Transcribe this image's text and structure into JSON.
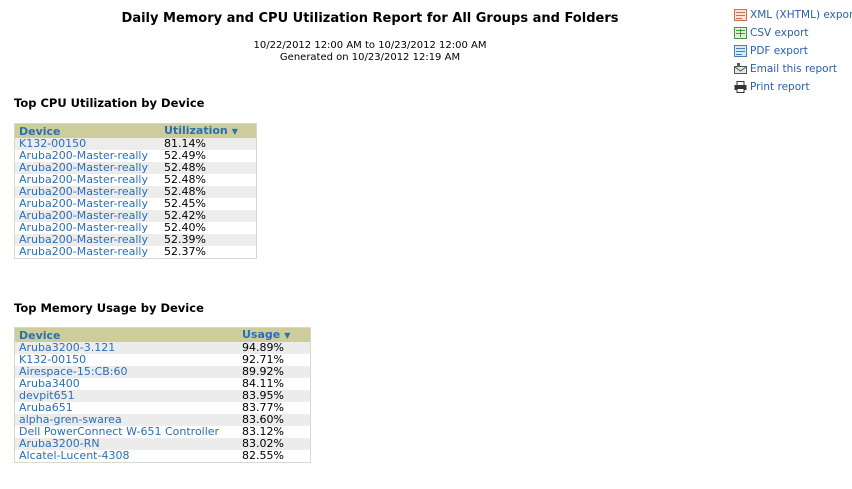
{
  "report": {
    "title": "Daily Memory and CPU Utilization Report for All Groups and Folders",
    "range": "10/22/2012 12:00 AM to 10/23/2012 12:00 AM",
    "generated": "Generated on 10/23/2012 12:19 AM"
  },
  "exports": [
    {
      "label": "XML (XHTML) export",
      "icon": "xml-export-icon"
    },
    {
      "label": "CSV export",
      "icon": "csv-export-icon"
    },
    {
      "label": "PDF export",
      "icon": "pdf-export-icon"
    },
    {
      "label": "Email this report",
      "icon": "email-icon"
    },
    {
      "label": "Print report",
      "icon": "printer-icon"
    }
  ],
  "cpu": {
    "heading": "Top CPU Utilization by Device",
    "col_device": "Device",
    "col_value": "Utilization",
    "rows": [
      {
        "device": "K132-00150",
        "value": "81.14%"
      },
      {
        "device": "Aruba200-Master-really",
        "value": "52.49%"
      },
      {
        "device": "Aruba200-Master-really",
        "value": "52.48%"
      },
      {
        "device": "Aruba200-Master-really",
        "value": "52.48%"
      },
      {
        "device": "Aruba200-Master-really",
        "value": "52.48%"
      },
      {
        "device": "Aruba200-Master-really",
        "value": "52.45%"
      },
      {
        "device": "Aruba200-Master-really",
        "value": "52.42%"
      },
      {
        "device": "Aruba200-Master-really",
        "value": "52.40%"
      },
      {
        "device": "Aruba200-Master-really",
        "value": "52.39%"
      },
      {
        "device": "Aruba200-Master-really",
        "value": "52.37%"
      }
    ]
  },
  "memory": {
    "heading": "Top Memory Usage by Device",
    "col_device": "Device",
    "col_value": "Usage",
    "rows": [
      {
        "device": "Aruba3200-3.121",
        "value": "94.89%"
      },
      {
        "device": "K132-00150",
        "value": "92.71%"
      },
      {
        "device": "Airespace-15:CB:60",
        "value": "89.92%"
      },
      {
        "device": "Aruba3400",
        "value": "84.11%"
      },
      {
        "device": "devpit651",
        "value": "83.95%"
      },
      {
        "device": "Aruba651",
        "value": "83.77%"
      },
      {
        "device": "alpha-gren-swarea",
        "value": "83.60%"
      },
      {
        "device": "Dell PowerConnect W-651 Controller",
        "value": "83.12%"
      },
      {
        "device": "Aruba3200-RN",
        "value": "83.02%"
      },
      {
        "device": "Alcatel-Lucent-4308",
        "value": "82.55%"
      }
    ]
  }
}
